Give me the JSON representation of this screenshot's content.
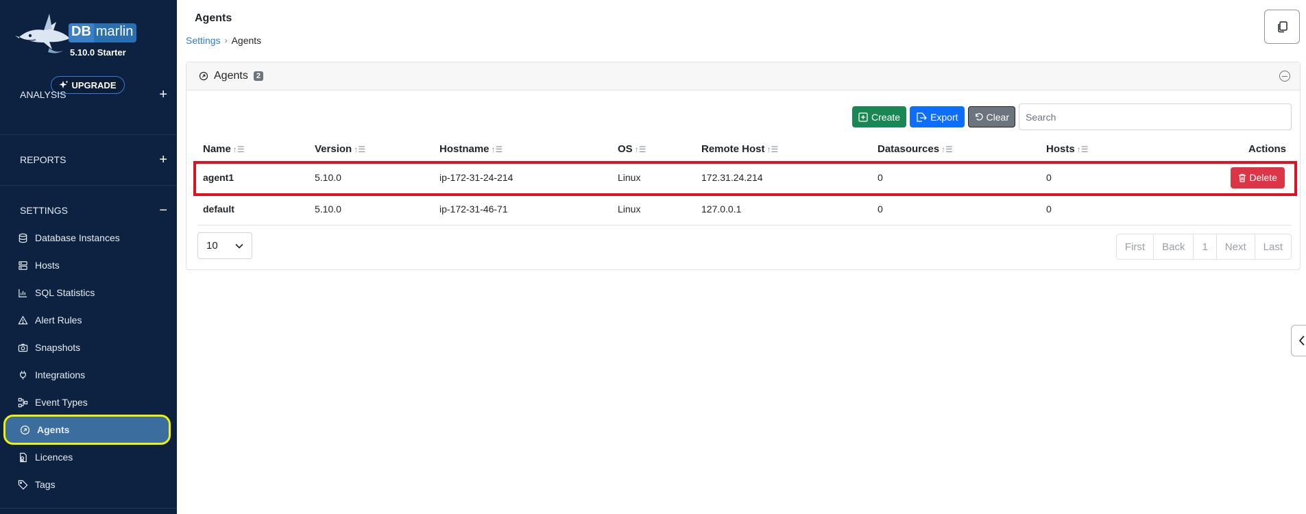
{
  "app": {
    "logo_db": "DB",
    "logo_marlin": "marlin",
    "version": "5.10.0 Starter",
    "upgrade_label": "UPGRADE"
  },
  "sidebar": {
    "sections": [
      {
        "label": "ANALYSIS",
        "toggle": "+"
      },
      {
        "label": "REPORTS",
        "toggle": "+"
      },
      {
        "label": "SETTINGS",
        "toggle": "−"
      }
    ],
    "items": [
      {
        "label": "Database Instances",
        "icon": "database-icon"
      },
      {
        "label": "Hosts",
        "icon": "server-icon"
      },
      {
        "label": "SQL Statistics",
        "icon": "chart-icon"
      },
      {
        "label": "Alert Rules",
        "icon": "warning-icon"
      },
      {
        "label": "Snapshots",
        "icon": "camera-icon"
      },
      {
        "label": "Integrations",
        "icon": "plug-icon"
      },
      {
        "label": "Event Types",
        "icon": "event-types-icon"
      },
      {
        "label": "Agents",
        "icon": "agent-icon",
        "active": true
      },
      {
        "label": "Licences",
        "icon": "licence-icon"
      },
      {
        "label": "Tags",
        "icon": "tag-icon"
      }
    ]
  },
  "header": {
    "title": "Agents",
    "breadcrumb": [
      "Settings",
      "Agents"
    ]
  },
  "card": {
    "title": "Agents",
    "count": "2",
    "toolbar": {
      "create_label": "Create",
      "export_label": "Export",
      "clear_label": "Clear",
      "search_placeholder": "Search"
    },
    "columns": [
      "Name",
      "Version",
      "Hostname",
      "OS",
      "Remote Host",
      "Datasources",
      "Hosts",
      "Actions"
    ],
    "rows": [
      {
        "name": "agent1",
        "version": "5.10.0",
        "hostname": "ip-172-31-24-214",
        "os": "Linux",
        "remote_host": "172.31.24.214",
        "datasources": "0",
        "hosts": "0",
        "action": "Delete"
      },
      {
        "name": "default",
        "version": "5.10.0",
        "hostname": "ip-172-31-46-71",
        "os": "Linux",
        "remote_host": "127.0.0.1",
        "datasources": "0",
        "hosts": "0"
      }
    ],
    "page_size": "10",
    "pager": [
      "First",
      "Back",
      "1",
      "Next",
      "Last"
    ]
  },
  "colors": {
    "sidebar_bg": "#0d2240",
    "active_item_bg": "#3b6e9e",
    "active_item_outline": "#f2f200",
    "row_highlight": "#e0101f",
    "create_btn": "#198754",
    "export_btn": "#0d6efd",
    "clear_btn": "#6c757d",
    "delete_btn": "#dc3545",
    "link": "#2f7bd8"
  }
}
